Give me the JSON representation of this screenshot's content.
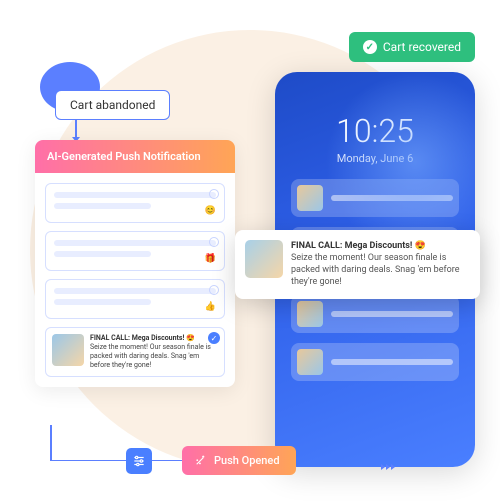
{
  "labels": {
    "cart_abandoned": "Cart abandoned",
    "cart_recovered": "Cart recovered",
    "panel_title": "AI-Generated Push Notification",
    "push_opened": "Push Opened"
  },
  "phone": {
    "time": "10:25",
    "date": "Monday, June 6"
  },
  "notification": {
    "title": "FINAL CALL: Mega Discounts!",
    "emoji": "😍",
    "body": "Seize the moment! Our season finale is packed with daring deals. Snag 'em before they're gone!"
  },
  "placeholder_emojis": [
    "😊",
    "🎁",
    "👍"
  ]
}
